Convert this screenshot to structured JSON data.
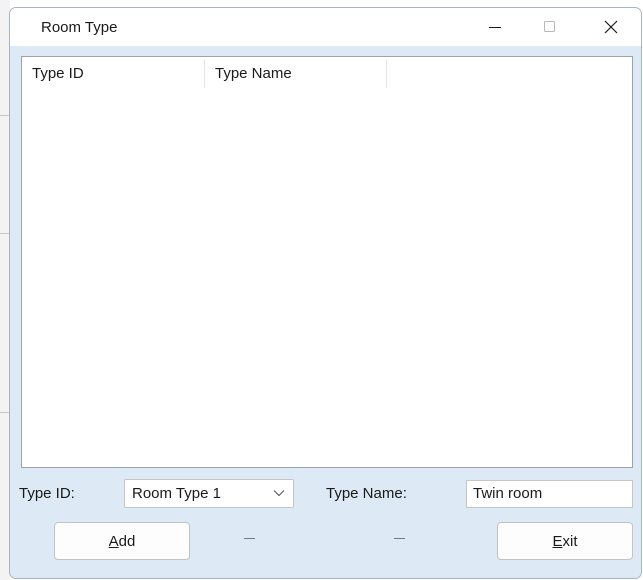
{
  "window": {
    "title": "Room Type"
  },
  "caption_buttons": {
    "minimize_icon": "minimize-icon",
    "maximize_icon": "maximize-icon",
    "close_icon": "close-icon"
  },
  "list": {
    "columns": [
      "Type ID",
      "Type Name"
    ],
    "rows": []
  },
  "form": {
    "type_id_label": "Type ID:",
    "type_id_value": "Room Type 1",
    "type_name_label": "Type Name:",
    "type_name_value": "Twin room"
  },
  "buttons": {
    "add": {
      "mnemonic": "A",
      "rest": "dd"
    },
    "exit": {
      "mnemonic": "E",
      "rest": "xit"
    }
  }
}
